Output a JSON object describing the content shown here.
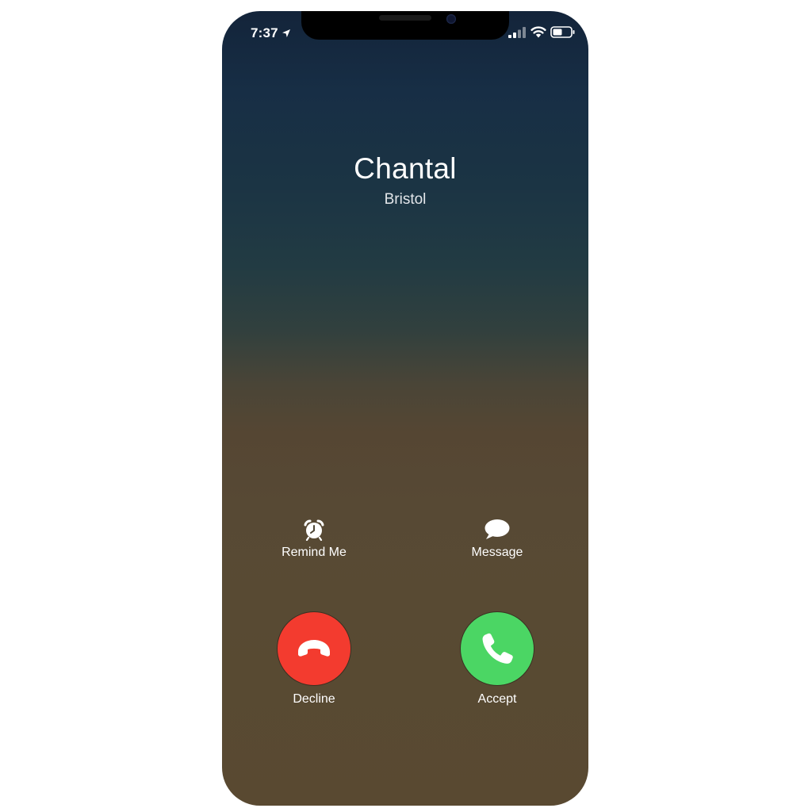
{
  "status_bar": {
    "time": "7:37",
    "icons": [
      "location-arrow-icon",
      "signal-icon",
      "wifi-icon",
      "battery-icon"
    ]
  },
  "caller": {
    "name": "Chantal",
    "location": "Bristol"
  },
  "secondary_actions": {
    "remind_label": "Remind Me",
    "remind_icon": "alarm-clock-icon",
    "message_label": "Message",
    "message_icon": "speech-bubble-icon"
  },
  "call_actions": {
    "decline_label": "Decline",
    "decline_icon": "hang-up-icon",
    "decline_color": "#f33b2f",
    "accept_label": "Accept",
    "accept_icon": "phone-icon",
    "accept_color": "#4bd664"
  }
}
